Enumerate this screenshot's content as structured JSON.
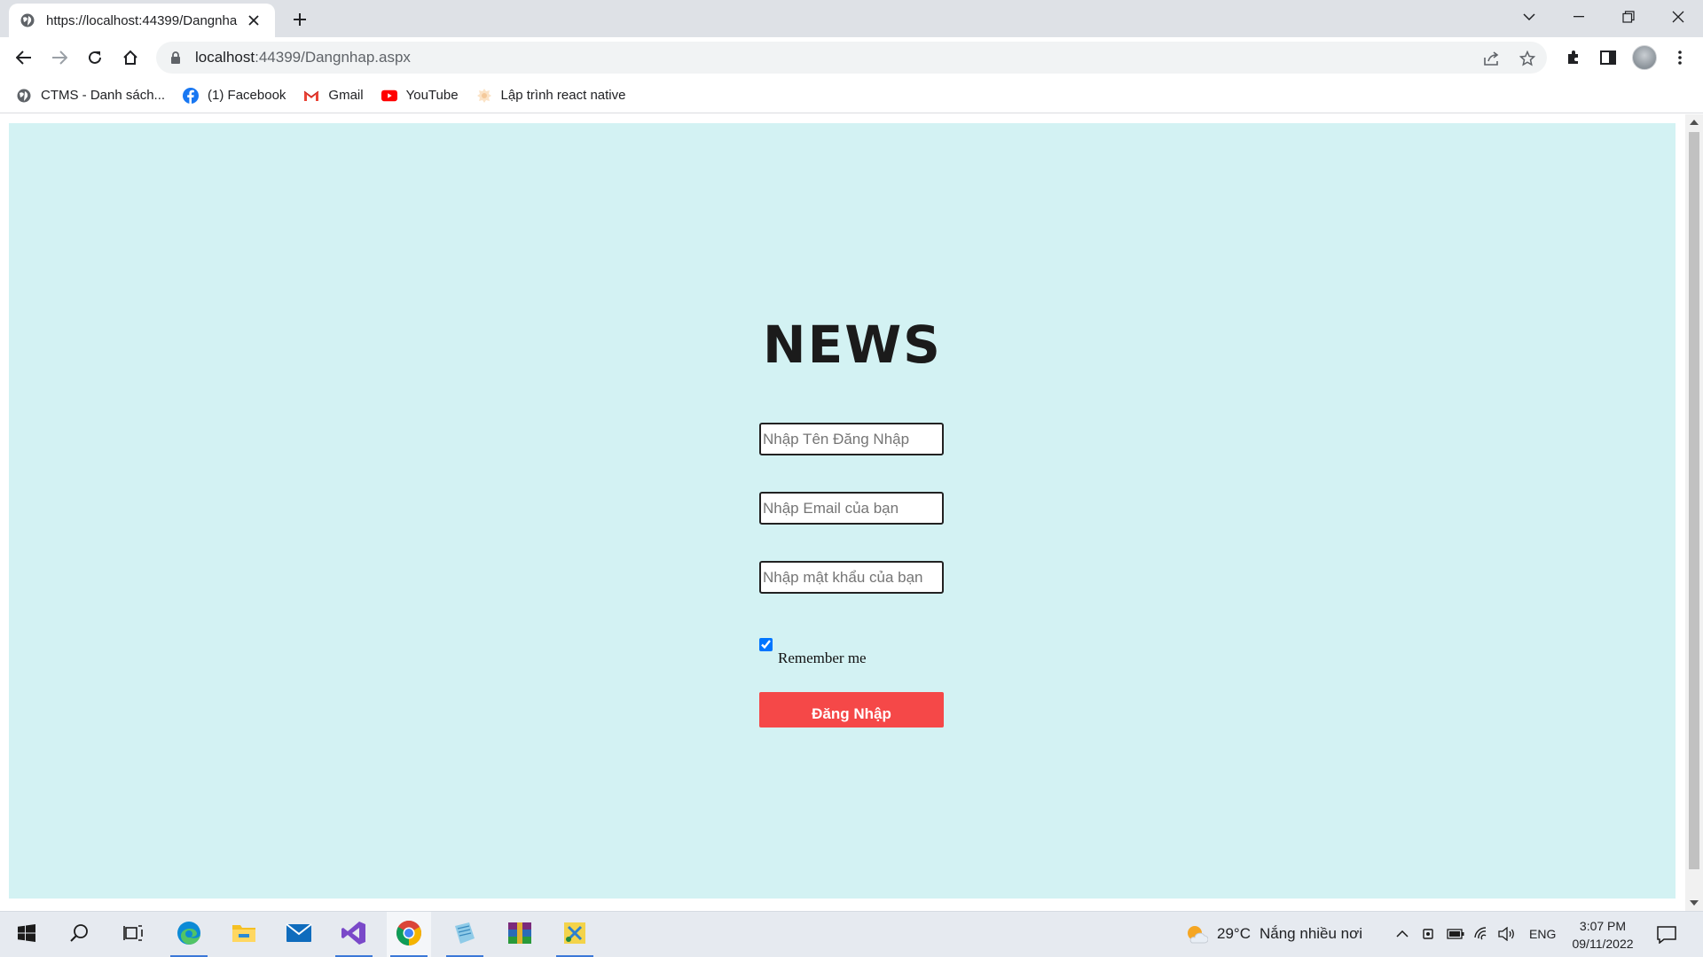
{
  "browser": {
    "tab": {
      "title": "https://localhost:44399/Dangnhap.aspx"
    },
    "address": {
      "host": "localhost",
      "path": ":44399/Dangnhap.aspx"
    },
    "bookmarks": [
      {
        "label": "CTMS - Danh sách...",
        "icon": "globe-icon"
      },
      {
        "label": "(1) Facebook",
        "icon": "facebook-icon"
      },
      {
        "label": "Gmail",
        "icon": "gmail-icon"
      },
      {
        "label": "YouTube",
        "icon": "youtube-icon"
      },
      {
        "label": "Lập trình react native",
        "icon": "react-icon"
      }
    ]
  },
  "page": {
    "brand": "NEWS",
    "username_placeholder": "Nhập Tên Đăng Nhập",
    "email_placeholder": "Nhập Email của bạn",
    "password_placeholder": "Nhập mật khẩu của bạn",
    "remember_label": "Remember me",
    "remember_checked": true,
    "submit_label": "Đăng Nhập",
    "background_color": "#d3f2f3",
    "button_color": "#f54848"
  },
  "taskbar": {
    "apps": [
      "start-icon",
      "search-icon",
      "task-view-icon",
      "edge-icon",
      "file-explorer-icon",
      "mail-icon",
      "visual-studio-icon",
      "chrome-icon",
      "notepad-icon",
      "winrar-icon",
      "snipping-tool-icon"
    ],
    "weather": {
      "temp": "29°C",
      "text": "Nắng nhiều nơi"
    },
    "language": "ENG",
    "time": "3:07 PM",
    "date": "09/11/2022"
  }
}
